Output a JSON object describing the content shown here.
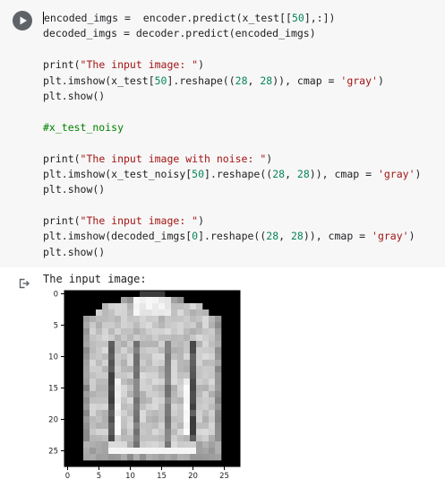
{
  "code_cell": {
    "lines": [
      [
        {
          "t": "encoded_imgs =  encoder.predict(x_test[[",
          "c": ""
        },
        {
          "t": "50",
          "c": "num"
        },
        {
          "t": "],:])",
          "c": ""
        }
      ],
      [
        {
          "t": "decoded_imgs = decoder.predict(encoded_imgs)",
          "c": ""
        }
      ],
      [],
      [
        {
          "t": "print(",
          "c": ""
        },
        {
          "t": "\"The input image: \"",
          "c": "str"
        },
        {
          "t": ")",
          "c": ""
        }
      ],
      [
        {
          "t": "plt.imshow(x_test[",
          "c": ""
        },
        {
          "t": "50",
          "c": "num"
        },
        {
          "t": "].reshape((",
          "c": ""
        },
        {
          "t": "28",
          "c": "num"
        },
        {
          "t": ", ",
          "c": ""
        },
        {
          "t": "28",
          "c": "num"
        },
        {
          "t": ")), cmap = ",
          "c": ""
        },
        {
          "t": "'gray'",
          "c": "str"
        },
        {
          "t": ")",
          "c": ""
        }
      ],
      [
        {
          "t": "plt.show()",
          "c": ""
        }
      ],
      [],
      [
        {
          "t": "#x_test_noisy",
          "c": "cmt"
        }
      ],
      [],
      [
        {
          "t": "print(",
          "c": ""
        },
        {
          "t": "\"The input image with noise: \"",
          "c": "str"
        },
        {
          "t": ")",
          "c": ""
        }
      ],
      [
        {
          "t": "plt.imshow(x_test_noisy[",
          "c": ""
        },
        {
          "t": "50",
          "c": "num"
        },
        {
          "t": "].reshape((",
          "c": ""
        },
        {
          "t": "28",
          "c": "num"
        },
        {
          "t": ", ",
          "c": ""
        },
        {
          "t": "28",
          "c": "num"
        },
        {
          "t": ")), cmap = ",
          "c": ""
        },
        {
          "t": "'gray'",
          "c": "str"
        },
        {
          "t": ")",
          "c": ""
        }
      ],
      [
        {
          "t": "plt.show()",
          "c": ""
        }
      ],
      [],
      [
        {
          "t": "print(",
          "c": ""
        },
        {
          "t": "\"The input image: \"",
          "c": "str"
        },
        {
          "t": ")",
          "c": ""
        }
      ],
      [
        {
          "t": "plt.imshow(decoded_imgs[",
          "c": ""
        },
        {
          "t": "0",
          "c": "num"
        },
        {
          "t": "].reshape((",
          "c": ""
        },
        {
          "t": "28",
          "c": "num"
        },
        {
          "t": ", ",
          "c": ""
        },
        {
          "t": "28",
          "c": "num"
        },
        {
          "t": ")), cmap = ",
          "c": ""
        },
        {
          "t": "'gray'",
          "c": "str"
        },
        {
          "t": ")",
          "c": ""
        }
      ],
      [
        {
          "t": "plt.show()",
          "c": ""
        }
      ]
    ]
  },
  "output": {
    "text": "The input image:"
  },
  "figure": {
    "colormap": "gray",
    "x_ticks": [
      "0",
      "5",
      "10",
      "15",
      "20",
      "25"
    ],
    "y_ticks": [
      "0",
      "5",
      "10",
      "15",
      "20",
      "25"
    ],
    "x_tick_values": [
      0,
      5,
      10,
      15,
      20,
      25
    ],
    "y_tick_values": [
      0,
      5,
      10,
      15,
      20,
      25
    ]
  }
}
